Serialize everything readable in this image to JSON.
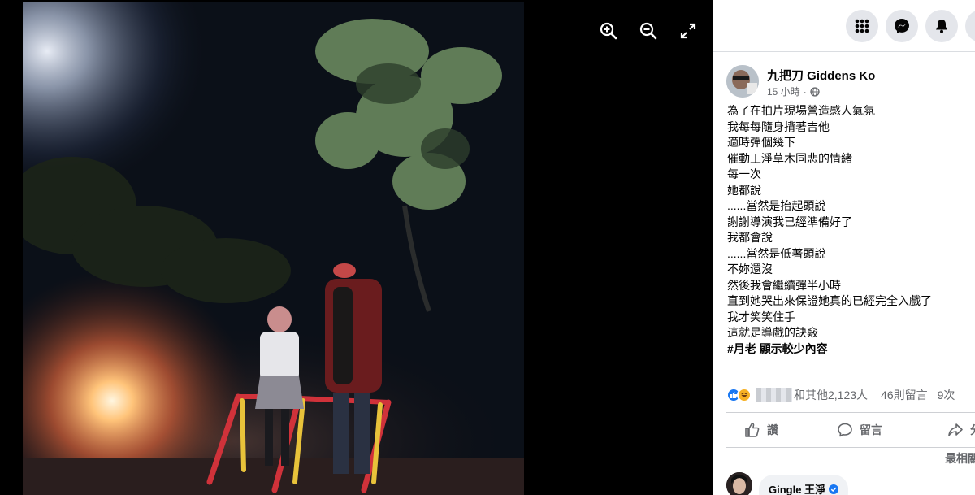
{
  "viewer": {
    "controls": [
      "zoom-in-icon",
      "zoom-out-icon",
      "fullscreen-icon"
    ]
  },
  "topbar": {
    "buttons": [
      "menu-grid-icon",
      "messenger-icon",
      "notifications-bell-icon",
      "account-icon"
    ]
  },
  "post": {
    "author": "九把刀 Giddens Ko",
    "time": "15 小時",
    "privacy_icon": "globe-icon",
    "lines": [
      "為了在拍片現場營造感人氣氛",
      "我每每隨身揹著吉他",
      "適時彈個幾下",
      "催動王淨草木同悲的情緒",
      "每一次",
      "她都說",
      "......當然是抬起頭說",
      "謝謝導演我已經準備好了",
      "我都會說",
      "......當然是低著頭說",
      "不妳還沒",
      "然後我會繼續彈半小時",
      "直到她哭出來保證她真的已經完全入戲了",
      "我才笑笑住手",
      "這就是導戲的訣竅"
    ],
    "hashtag": "#月老",
    "see_more": "顯示較少內容",
    "reactions_text": "和其他2,123人",
    "comments_text": "46則留言",
    "shares_text": "9次",
    "actions": {
      "like": "讚",
      "comment": "留言",
      "share": "分享"
    },
    "sort_label": "最相關",
    "first_comment_author": "Gingle 王淨"
  },
  "colors": {
    "accent": "#1877f2",
    "like_blue": "#1877f2",
    "haha_yellow": "#f7b125",
    "text": "#050505",
    "muted": "#65676b"
  }
}
